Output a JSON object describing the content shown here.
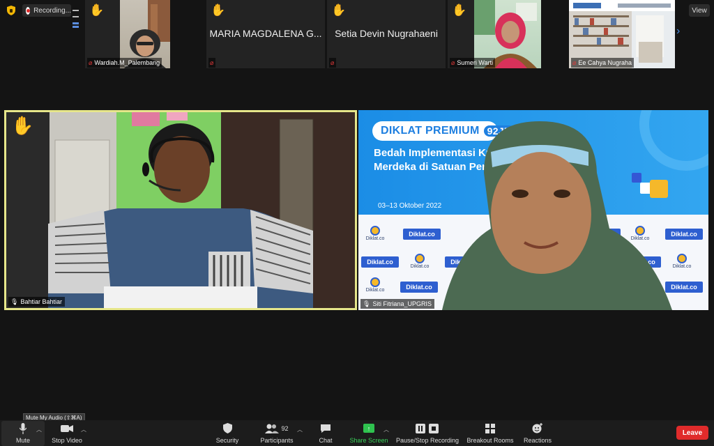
{
  "recording": {
    "label": "Recording..."
  },
  "view_button": "View",
  "thumbnails": [
    {
      "name": "Wardiah.M_Palembang",
      "show_video": true
    },
    {
      "name": "MARIA MAGDALENA G...",
      "full_name": "MARIA MAGDALENA G...",
      "show_video": false
    },
    {
      "name": "Setia Devin Nugrahaeni",
      "full_name": "Setia Devin Nugrahaeni",
      "show_video": false
    },
    {
      "name": "Sumeri Warti",
      "show_video": true
    },
    {
      "name": "Ee Cahya Nugraha",
      "show_video": true
    }
  ],
  "main_tiles": {
    "active": {
      "name": "Bahtiar Bahtiar"
    },
    "second": {
      "name": "Siti Fitriana_UPGRIS",
      "slide": {
        "banner": "DIKLAT PREMIUM",
        "banner_num": "92JP",
        "title_line1": "Bedah Implementasi Kurikulum",
        "title_line2": "Merdeka di Satuan Pendidikan",
        "date": "03–13 Oktober 2022",
        "logo_text": "Diklat.co",
        "logo_small": "Diklat.co"
      }
    }
  },
  "tooltip": "Mute My Audio (⇧⌘A)",
  "toolbar": {
    "mute": "Mute",
    "stop_video": "Stop Video",
    "security": "Security",
    "participants": "Participants",
    "participant_count": "92",
    "chat": "Chat",
    "share_screen": "Share Screen",
    "pause_stop_recording": "Pause/Stop Recording",
    "breakout_rooms": "Breakout Rooms",
    "reactions": "Reactions",
    "leave": "Leave"
  },
  "colors": {
    "active_speaker_border": "#e6e68a",
    "share_green": "#2fc24f",
    "leave_red": "#e02b2b",
    "slide_blue": "#1e7fe0"
  }
}
